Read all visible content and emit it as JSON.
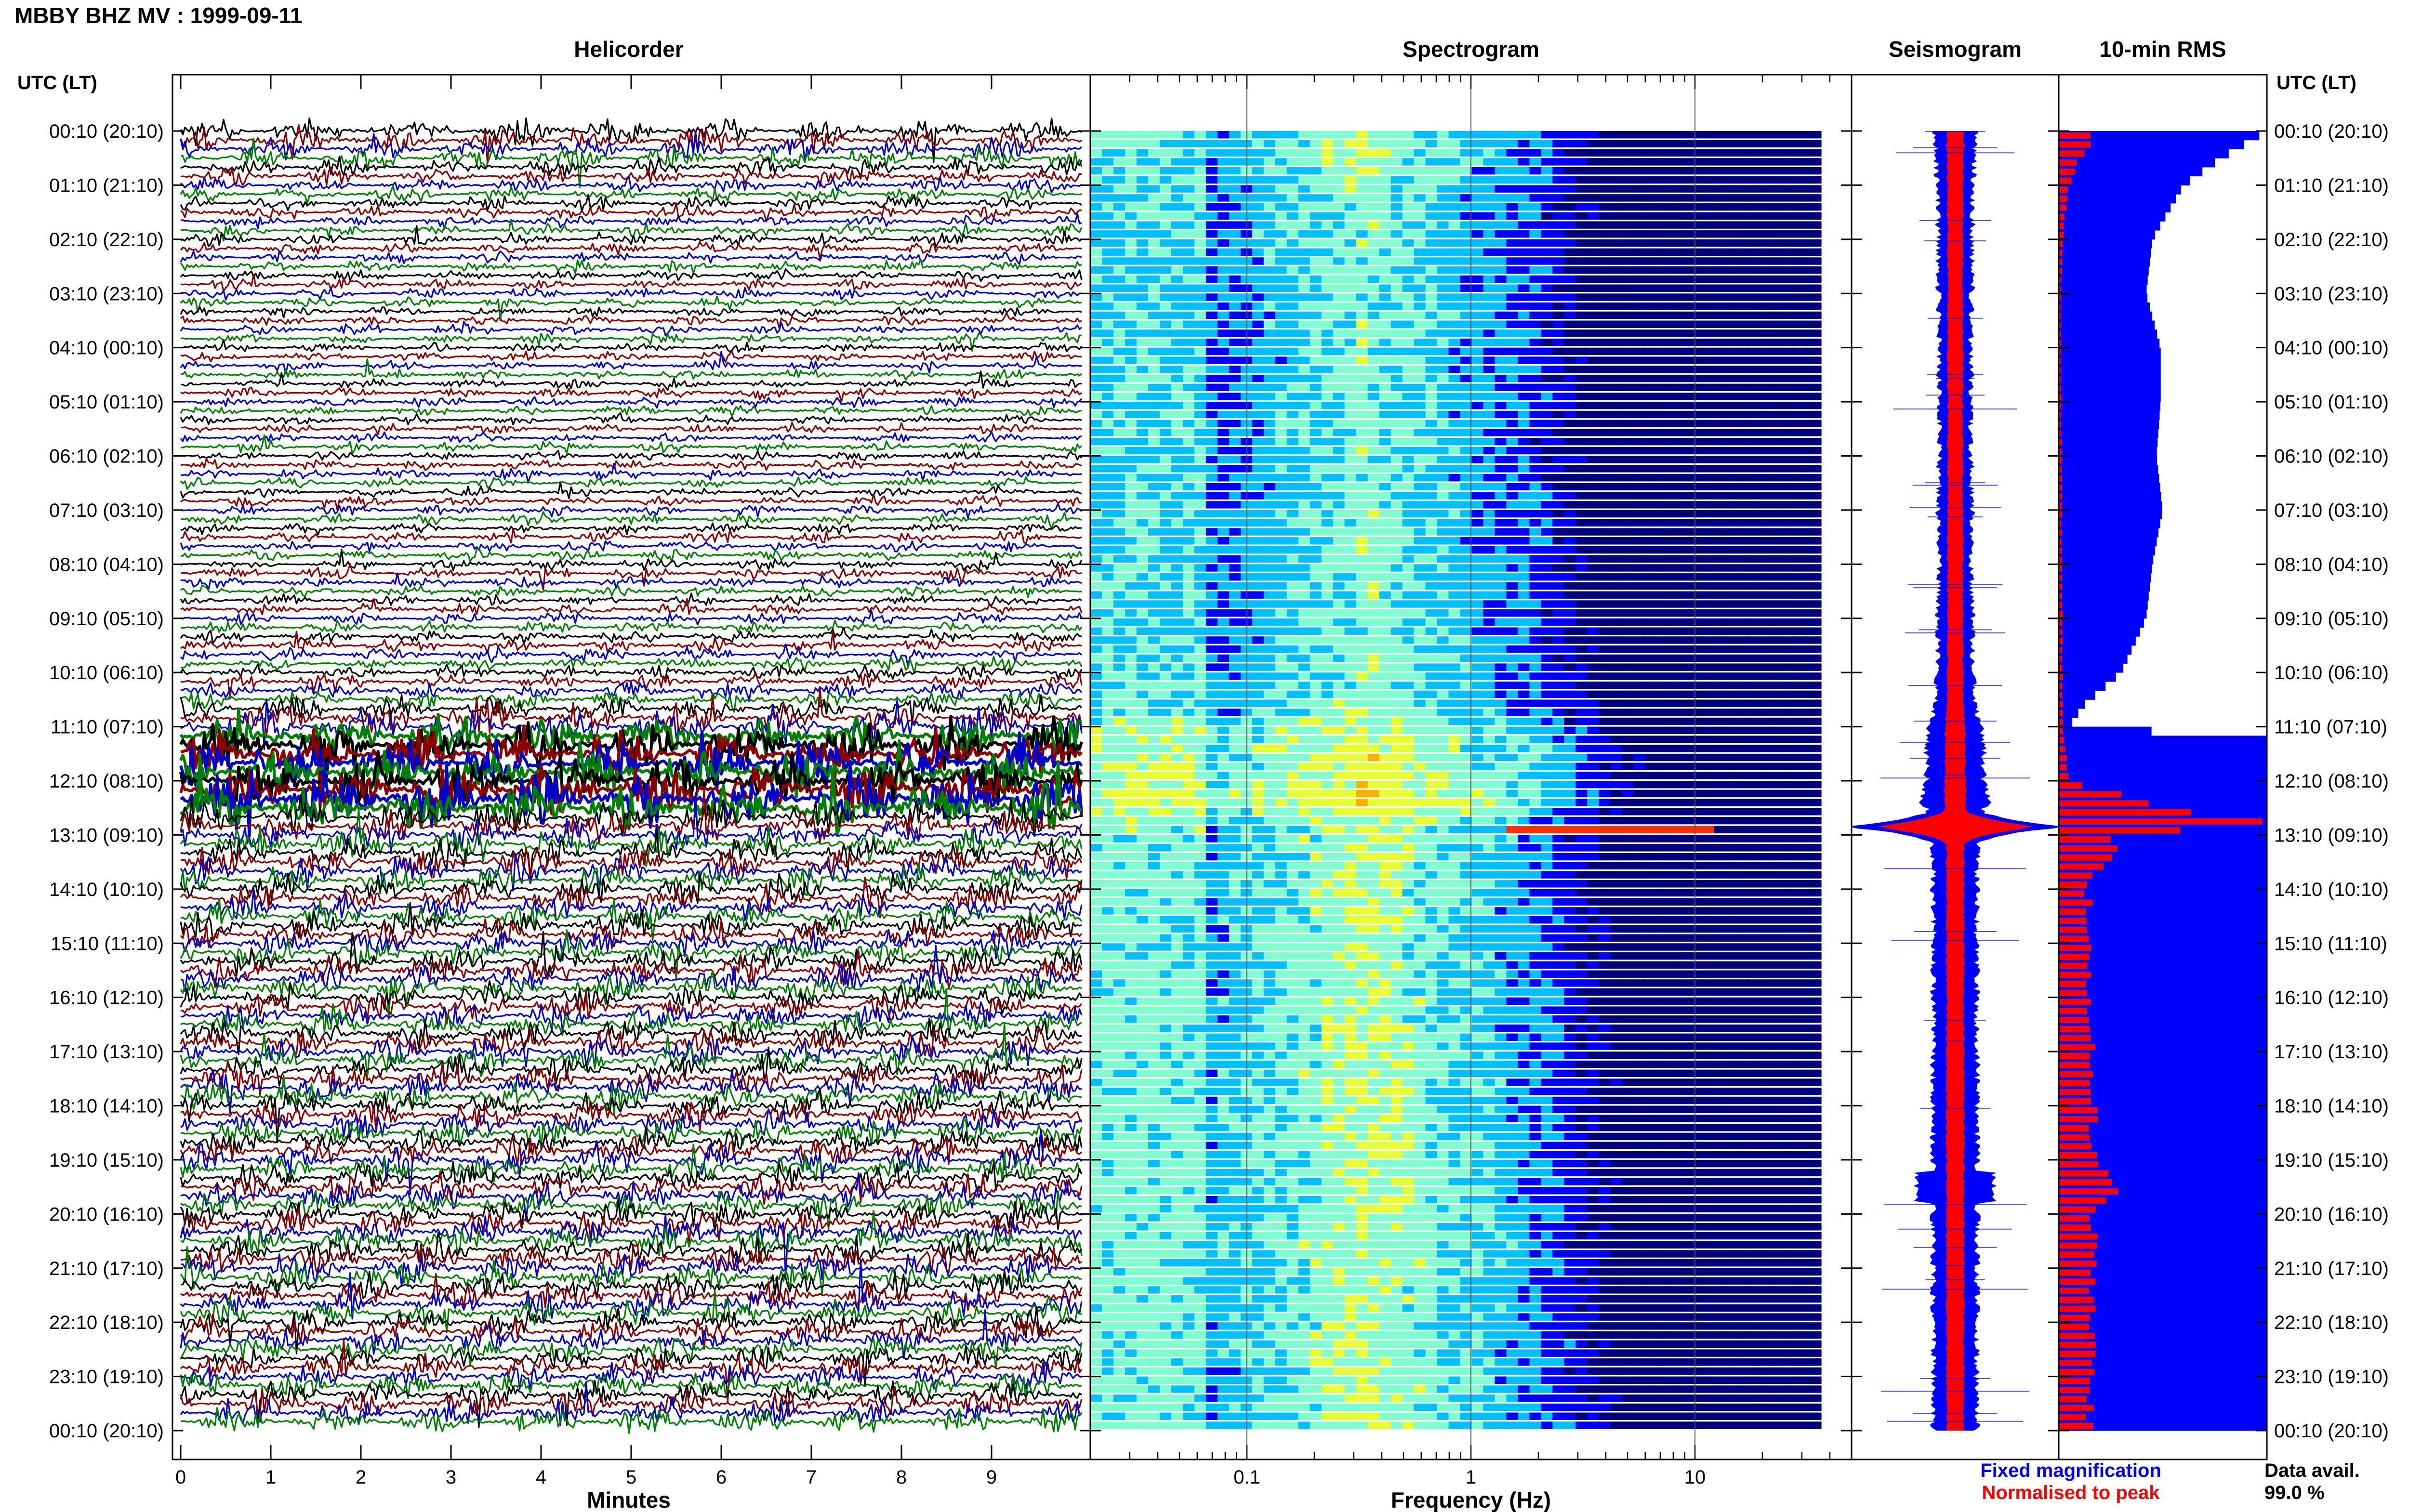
{
  "header": {
    "title": "MBBY BHZ MV : 1999-09-11"
  },
  "colors": {
    "trace": [
      "#000000",
      "#8b0000",
      "#0000cc",
      "#008000"
    ],
    "fixed": "#0000ff",
    "normalised": "#ff0000",
    "spectrogram_ramp": [
      "#00007f",
      "#0000ff",
      "#00bfff",
      "#7fffcf",
      "#e6ff33",
      "#ffb000",
      "#ff3000"
    ]
  },
  "chart_data": [
    {
      "type": "line",
      "panel": "helicorder",
      "title": "Helicorder",
      "xlabel": "Minutes",
      "ylabel": "UTC (LT)",
      "xlim": [
        0,
        10
      ],
      "xticks": [
        "0",
        "1",
        "2",
        "3",
        "4",
        "5",
        "6",
        "7",
        "8",
        "9"
      ],
      "row_minutes": 10,
      "rows": 144,
      "row_time_labels": [
        "00:10 (20:10)",
        "01:10 (21:10)",
        "02:10 (22:10)",
        "03:10 (23:10)",
        "04:10 (00:10)",
        "05:10 (01:10)",
        "06:10 (02:10)",
        "07:10 (03:10)",
        "08:10 (04:10)",
        "09:10 (05:10)",
        "10:10 (06:10)",
        "11:10 (07:10)",
        "12:10 (08:10)",
        "13:10 (09:10)",
        "14:10 (10:10)",
        "15:10 (11:10)",
        "16:10 (12:10)",
        "17:10 (13:10)",
        "18:10 (14:10)",
        "19:10 (15:10)",
        "20:10 (16:10)",
        "21:10 (17:10)",
        "22:10 (18:10)",
        "23:10 (19:10)",
        "00:10 (20:10)"
      ],
      "amplitude_profile": {
        "hours": [
          0,
          0.5,
          1,
          2,
          3,
          4,
          5,
          6,
          7,
          8,
          9,
          10,
          10.5,
          11,
          11.3,
          12,
          12.4,
          12.6,
          13,
          14,
          15,
          16,
          17,
          18,
          19,
          20,
          21,
          22,
          23,
          24
        ],
        "relative": [
          1.0,
          0.75,
          0.55,
          0.45,
          0.4,
          0.38,
          0.38,
          0.38,
          0.4,
          0.42,
          0.45,
          0.55,
          0.7,
          1.4,
          1.8,
          1.8,
          2.4,
          1.3,
          1.1,
          1.0,
          1.0,
          1.0,
          1.05,
          1.05,
          1.05,
          1.05,
          1.05,
          1.0,
          1.0,
          1.0
        ]
      }
    },
    {
      "type": "heatmap",
      "panel": "spectrogram",
      "title": "Spectrogram",
      "xlabel": "Frequency (Hz)",
      "xscale": "log",
      "xlim": [
        0.02,
        50
      ],
      "xticks": [
        "0.1",
        "1",
        "10"
      ],
      "peak_band_hz": [
        0.2,
        0.5
      ],
      "notable_event": {
        "time": "12:50",
        "band_hz": [
          1.5,
          12
        ]
      }
    },
    {
      "type": "area",
      "panel": "seismogram",
      "title": "Seismogram",
      "series": [
        {
          "name": "Fixed magnification",
          "color": "#0000ff"
        },
        {
          "name": "Normalised to peak",
          "color": "#ff0000"
        }
      ],
      "peak_time": "12:50"
    },
    {
      "type": "bar",
      "panel": "rms",
      "title": "10-min RMS",
      "orientation": "horizontal",
      "ylabel": "UTC (LT)",
      "series": [
        {
          "name": "Fixed magnification",
          "color": "#0000ff",
          "hours": [
            0,
            0.5,
            1,
            2,
            3,
            4,
            5,
            6,
            7,
            8,
            9,
            10,
            10.6,
            11,
            11.2,
            12,
            24
          ],
          "relative": [
            1.0,
            0.78,
            0.6,
            0.45,
            0.42,
            0.49,
            0.49,
            0.47,
            0.5,
            0.45,
            0.42,
            0.3,
            0.12,
            0.05,
            1.0,
            1.0,
            1.0
          ]
        },
        {
          "name": "Normalised to peak",
          "color": "#ff0000",
          "hours": [
            0,
            0.5,
            1,
            2,
            3,
            11,
            12,
            12.6,
            12.8,
            13,
            14,
            19,
            19.5,
            20,
            24
          ],
          "relative": [
            0.2,
            0.1,
            0.05,
            0.02,
            0.01,
            0.02,
            0.05,
            0.6,
            1.0,
            0.3,
            0.15,
            0.18,
            0.28,
            0.18,
            0.16
          ]
        }
      ]
    }
  ],
  "rms_ticks": [
    "00:10 (20:10)",
    "01:10 (21:10)",
    "02:10 (22:10)",
    "03:10 (23:10)",
    "04:10 (00:10)",
    "05:10 (01:10)",
    "06:10 (02:10)",
    "07:10 (03:10)",
    "08:10 (04:10)",
    "09:10 (05:10)",
    "10:10 (06:10)",
    "11:10 (07:10)",
    "12:10 (08:10)",
    "13:10 (09:10)",
    "14:10 (10:10)",
    "15:10 (11:10)",
    "16:10 (12:10)",
    "17:10 (13:10)",
    "18:10 (14:10)",
    "19:10 (15:10)",
    "20:10 (16:10)",
    "21:10 (17:10)",
    "22:10 (18:10)",
    "23:10 (19:10)",
    "00:10 (20:10)"
  ],
  "axis_left_title": "UTC (LT)",
  "axis_right_title": "UTC (LT)",
  "legend": {
    "fixed": "Fixed magnification",
    "normalised": "Normalised to peak"
  },
  "availability": {
    "label": "Data avail.",
    "value": "99.0 %"
  }
}
